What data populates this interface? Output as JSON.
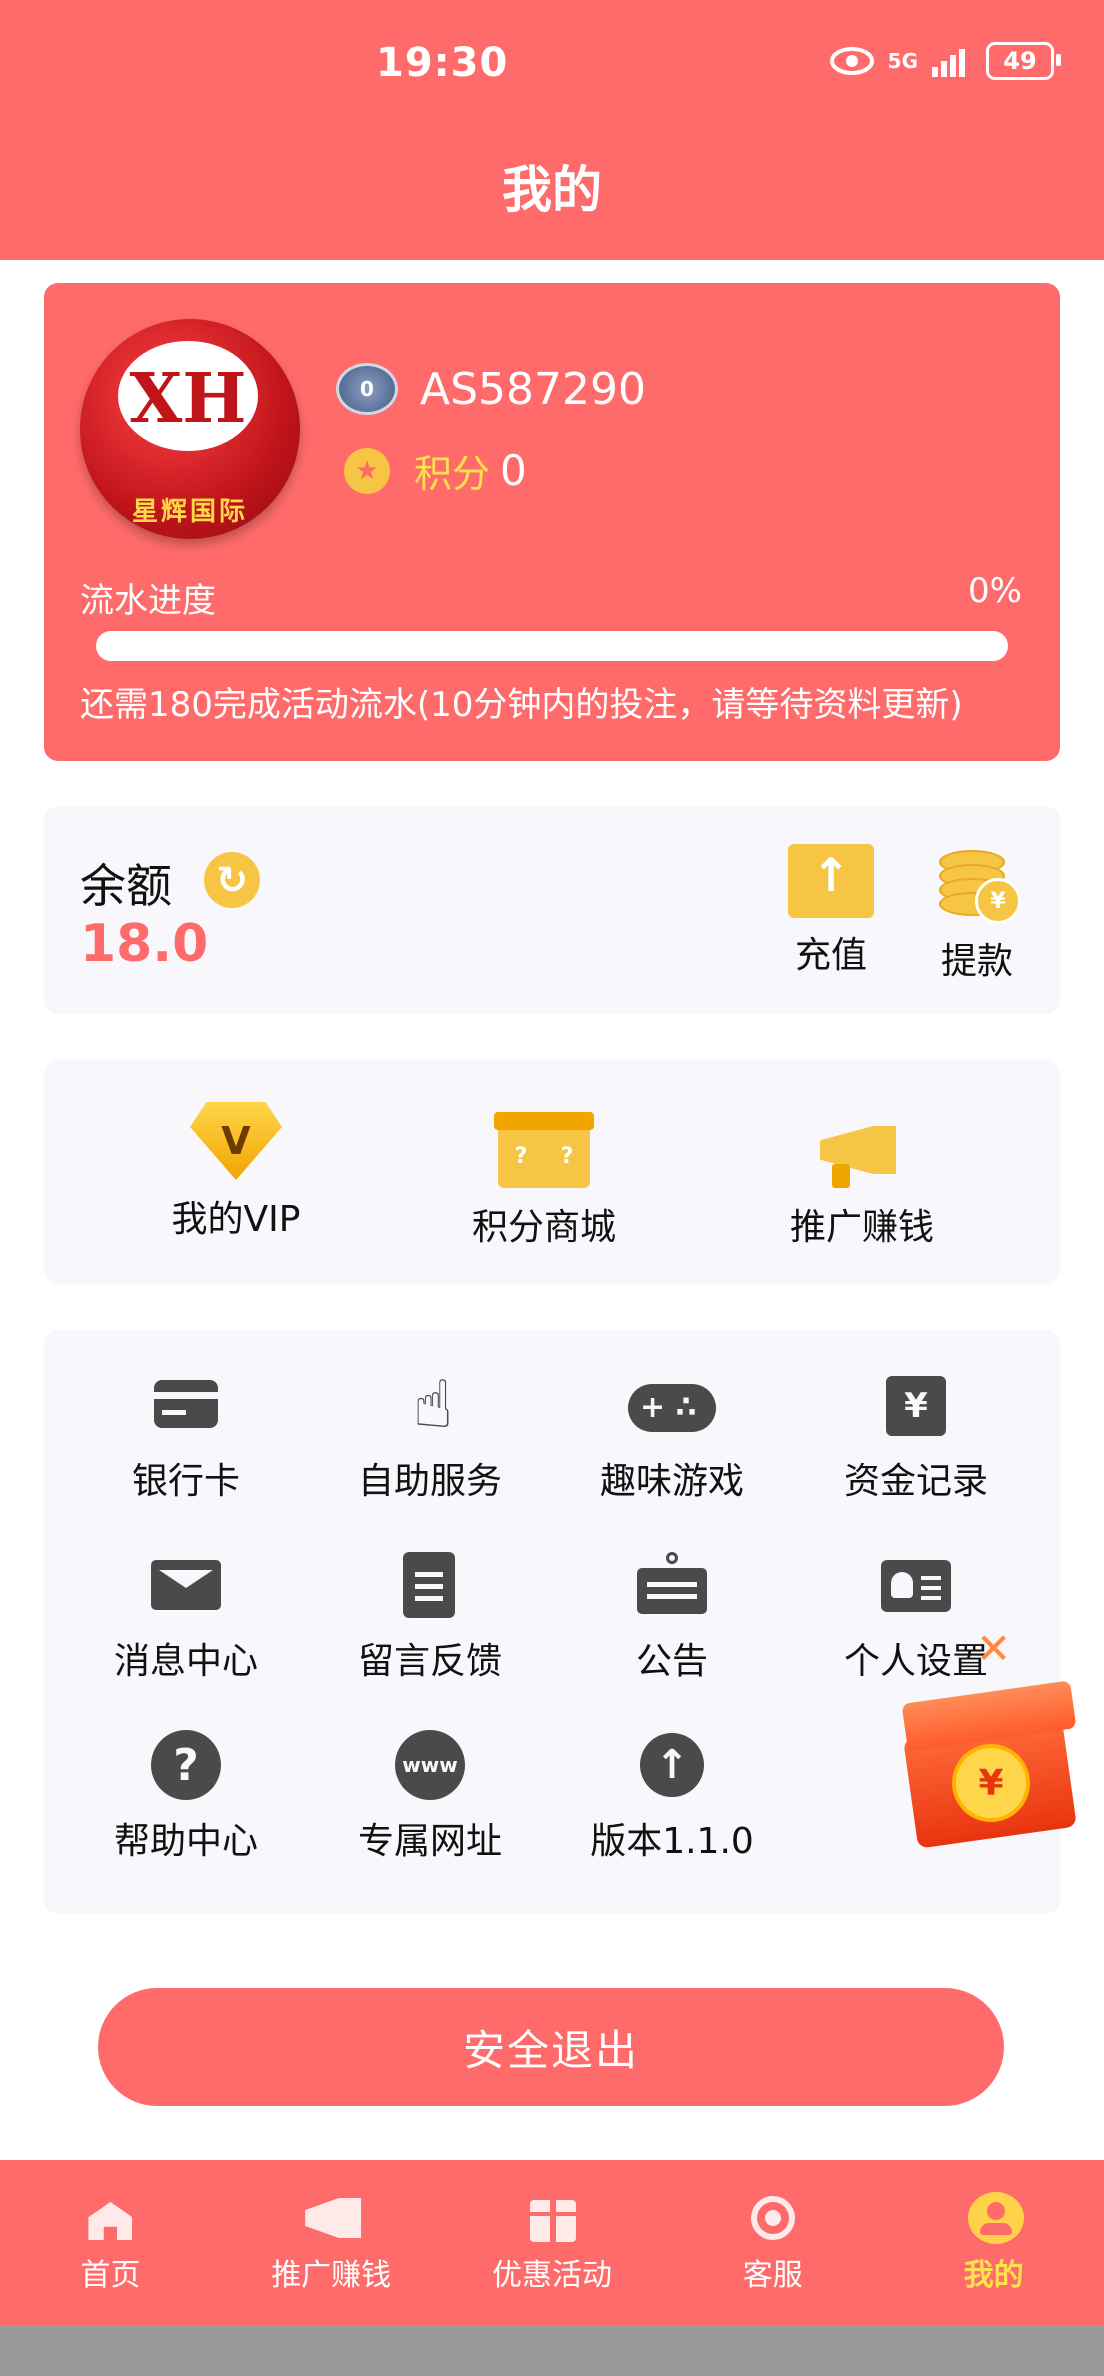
{
  "status_bar": {
    "time": "19:30",
    "network": "5G",
    "battery": "49"
  },
  "header": {
    "title": "我的"
  },
  "profile": {
    "avatar_logo": "XH",
    "avatar_caption": "星辉国际",
    "level_badge": "0",
    "username": "AS587290",
    "points_label": "积分",
    "points_value": "0",
    "progress_label": "流水进度",
    "progress_percent_text": "0%",
    "progress_fraction": 0,
    "progress_note": "还需180完成活动流水(10分钟内的投注，请等待资料更新)"
  },
  "balance": {
    "label": "余额",
    "value": "18.0",
    "recharge_label": "充值",
    "withdraw_label": "提款"
  },
  "features": [
    {
      "label": "我的VIP",
      "icon": "vip-diamond-icon"
    },
    {
      "label": "积分商城",
      "icon": "gift-box-icon"
    },
    {
      "label": "推广赚钱",
      "icon": "megaphone-icon"
    }
  ],
  "grid": [
    {
      "label": "银行卡",
      "icon": "bank-card-icon"
    },
    {
      "label": "自助服务",
      "icon": "hand-pointer-icon"
    },
    {
      "label": "趣味游戏",
      "icon": "gamepad-icon"
    },
    {
      "label": "资金记录",
      "icon": "fund-record-icon"
    },
    {
      "label": "消息中心",
      "icon": "mail-icon"
    },
    {
      "label": "留言反馈",
      "icon": "feedback-icon"
    },
    {
      "label": "公告",
      "icon": "notice-board-icon"
    },
    {
      "label": "个人设置",
      "icon": "id-card-icon"
    },
    {
      "label": "帮助中心",
      "icon": "help-icon"
    },
    {
      "label": "专属网址",
      "icon": "globe-icon"
    },
    {
      "label": "版本1.1.0",
      "icon": "upload-icon"
    }
  ],
  "logout_label": "安全退出",
  "tabs": [
    {
      "label": "首页",
      "icon": "home-icon",
      "active": false
    },
    {
      "label": "推广赚钱",
      "icon": "megaphone-icon",
      "active": false
    },
    {
      "label": "优惠活动",
      "icon": "gift-icon",
      "active": false
    },
    {
      "label": "客服",
      "icon": "customer-service-icon",
      "active": false
    },
    {
      "label": "我的",
      "icon": "user-icon",
      "active": true
    }
  ],
  "colors": {
    "primary": "#FF6B6B",
    "accent_yellow": "#FFE14D",
    "gold": "#F6C543",
    "card_bg": "#F7F7FC",
    "icon_dark": "#4A4A4A"
  }
}
